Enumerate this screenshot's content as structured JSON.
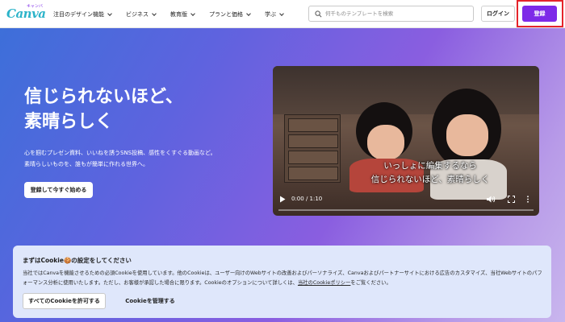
{
  "logo": {
    "main": "Canva",
    "superscript": "キャンバ"
  },
  "nav": [
    {
      "label": "注目のデザイン機能"
    },
    {
      "label": "ビジネス"
    },
    {
      "label": "教育版"
    },
    {
      "label": "プランと価格"
    },
    {
      "label": "学ぶ"
    }
  ],
  "search": {
    "placeholder": "何千ものテンプレートを検索",
    "value": ""
  },
  "header": {
    "login_label": "ログイン",
    "signup_label": "登録"
  },
  "hero": {
    "title_line1": "信じられないほど、",
    "title_line2": "素晴らしく",
    "desc_line1": "心を掴むプレゼン資料、いいねを誘うSNS投稿、感性をくすぐる動画など。",
    "desc_line2": "素晴らしいものを、誰もが簡単に作れる世界へ。",
    "cta_label": "登録して今すぐ始める"
  },
  "video": {
    "caption_line1": "いっしょに編集するなら",
    "caption_line2": "信じられないほど、素晴らしく",
    "time": "0:00 / 1:10",
    "progress": 0
  },
  "cookie": {
    "title": "まずはCookie🍪の設定をしてください",
    "text_before_link": "当社ではCanvaを機能させるための必須Cookieを使用しています。他のCookieは、ユーザー向けのWebサイトの改善およびパーソナライズ、Canvaおよびパートナーサイトにおける広告のカスタマイズ、当社Webサイトのパフォーマンス分析に使用いたします。ただし、お客様が承認した場合に限ります。Cookieのオプションについて詳しくは、",
    "link_label": "当社のCookieポリシー",
    "text_after_link": "をご覧ください。",
    "allow_label": "すべてのCookieを許可する",
    "manage_label": "Cookieを管理する"
  },
  "colors": {
    "brand": "#7d2ae8",
    "logo": "#2bb3c9",
    "highlight": "#e5242b"
  }
}
